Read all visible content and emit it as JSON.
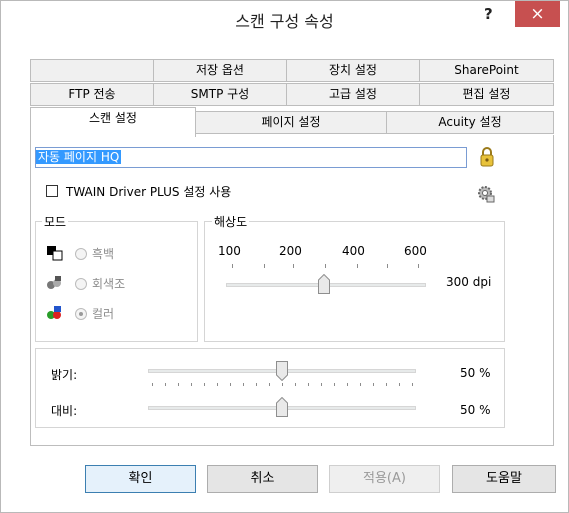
{
  "window": {
    "title": "스캔 구성 속성",
    "help": "?",
    "close": "×"
  },
  "tabs": {
    "row1": [
      "저장 옵션",
      "장치 설정",
      "SharePoint"
    ],
    "row2": [
      "FTP 전송",
      "SMTP 구성",
      "고급 설정",
      "편집 설정"
    ],
    "row3": [
      "스캔 설정",
      "페이지 설정",
      "Acuity 설정"
    ]
  },
  "profile_name": "자동 페이지 HQ",
  "twain_checkbox": {
    "label": "TWAIN Driver PLUS 설정 사용",
    "checked": false
  },
  "mode": {
    "legend": "모드",
    "options": [
      "흑백",
      "회색조",
      "컬러"
    ],
    "selected": "컬러"
  },
  "resolution": {
    "legend": "해상도",
    "ticks": [
      "100",
      "200",
      "400",
      "600"
    ],
    "value_text": "300 dpi",
    "value": 300
  },
  "brightness": {
    "label": "밝기:",
    "value_text": "50 %",
    "value": 50
  },
  "contrast": {
    "label": "대비:",
    "value_text": "50 %",
    "value": 50
  },
  "buttons": {
    "ok": "확인",
    "cancel": "취소",
    "apply": "적용(A)",
    "help": "도움말"
  },
  "colors": {
    "close_button": "#c75050",
    "selection": "#3399ff",
    "tab_bg": "#f0f0f0"
  }
}
